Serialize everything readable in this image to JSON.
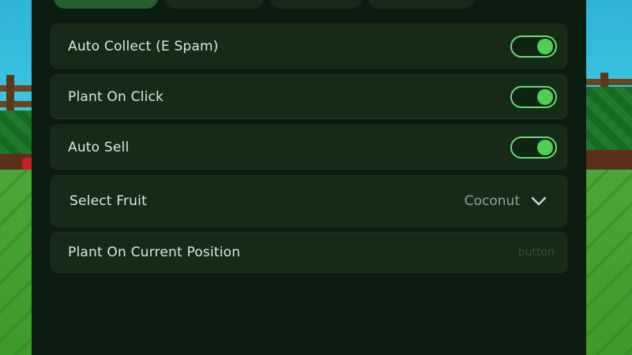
{
  "tabs": [
    {
      "id": "tab-1",
      "active": true
    },
    {
      "id": "tab-2",
      "active": false
    },
    {
      "id": "tab-3",
      "active": false
    },
    {
      "id": "tab-4",
      "active": false
    }
  ],
  "rows": {
    "auto_collect": {
      "label": "Auto Collect (E Spam)",
      "enabled": true
    },
    "plant_on_click": {
      "label": "Plant On Click",
      "enabled": true
    },
    "auto_sell": {
      "label": "Auto Sell",
      "enabled": true
    },
    "select_fruit": {
      "label": "Select Fruit",
      "value": "Coconut",
      "icon": "chevron-down-icon"
    },
    "plant_on_position": {
      "label": "Plant On Current Position",
      "hint": "button"
    }
  },
  "colors": {
    "panel_bg": "#0d1c10",
    "row_bg": "#152a17",
    "toggle_on": "#4ed052",
    "toggle_border": "#6fd876",
    "active_tab": "#245f2c"
  }
}
